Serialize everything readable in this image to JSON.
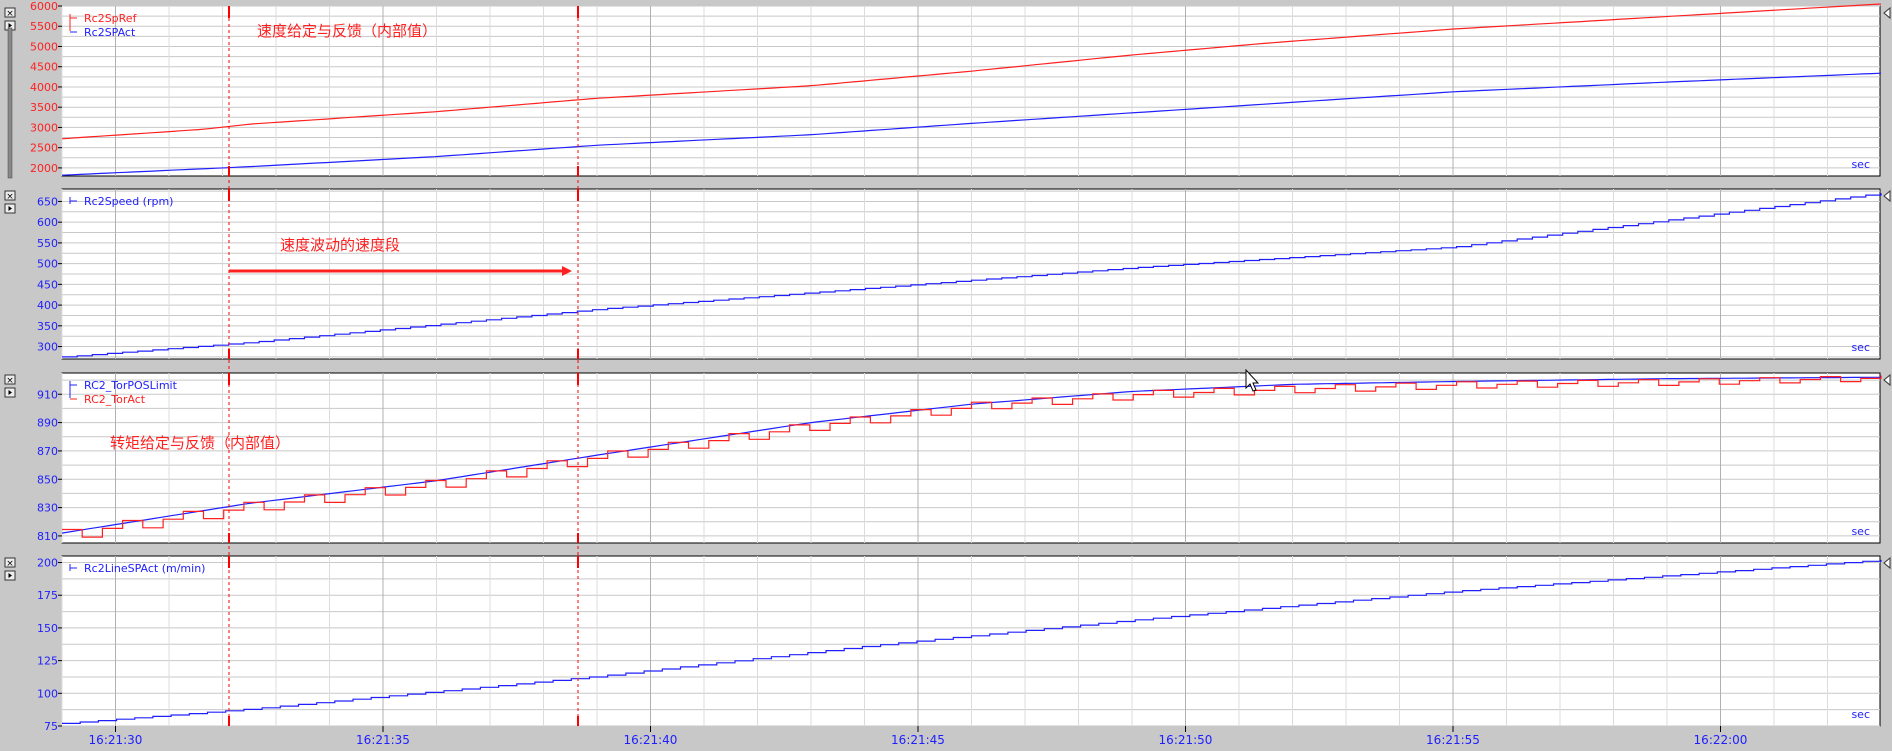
{
  "colors": {
    "ref": "#ff2020",
    "act": "#2020ff",
    "grid": "#c8c8c8",
    "plot_bg": "#ffffff",
    "cursor": "#ff0000"
  },
  "time_axis": {
    "ticks": [
      "16:21:30",
      "16:21:35",
      "16:21:40",
      "16:21:45",
      "16:21:50",
      "16:21:55",
      "16:22:00"
    ],
    "unit_label": "sec"
  },
  "annotations": {
    "speed_ref_feedback": "速度给定与反馈（内部值）",
    "speed_fluctuation": "速度波动的速度段",
    "torque_ref_feedback": "转矩给定与反馈（内部值）"
  },
  "cursors": {
    "t1": "16:21:31.9",
    "t2": "16:21:38.4"
  },
  "chart_data": [
    {
      "type": "line",
      "ylim": [
        1800,
        6000
      ],
      "yticks": [
        2000,
        2500,
        3000,
        3500,
        4000,
        4500,
        5000,
        5500,
        6000
      ],
      "ytick_color": "#ff2020",
      "x_range_sec": [
        0,
        34.0
      ],
      "series": [
        {
          "name": "Rc2SpRef",
          "color": "#ff2020",
          "x": [
            0,
            2.6,
            3.5,
            7,
            10,
            14,
            17,
            20,
            22.5,
            26,
            30,
            34.0
          ],
          "values": [
            2720,
            2950,
            3080,
            3390,
            3720,
            4030,
            4390,
            4790,
            5080,
            5430,
            5740,
            6050
          ],
          "steps": 0
        },
        {
          "name": "Rc2SPAct",
          "color": "#2020ff",
          "x": [
            0,
            3.5,
            7,
            10,
            14,
            17,
            20,
            26,
            30,
            34.0
          ],
          "values": [
            1820,
            2030,
            2280,
            2560,
            2820,
            3100,
            3360,
            3880,
            4120,
            4340
          ],
          "steps": 0
        }
      ]
    },
    {
      "type": "line",
      "ylim": [
        270,
        680
      ],
      "yticks": [
        300,
        350,
        400,
        450,
        500,
        550,
        600,
        650
      ],
      "ytick_color": "#2020ff",
      "x_range_sec": [
        0,
        34.0
      ],
      "series": [
        {
          "name": "Rc2Speed (rpm)",
          "color": "#2020ff",
          "x": [
            0,
            3.5,
            10,
            15,
            20,
            26,
            34.0
          ],
          "values": [
            275,
            310,
            390,
            440,
            490,
            540,
            670
          ],
          "steps": 120
        }
      ]
    },
    {
      "type": "line",
      "ylim": [
        805,
        925
      ],
      "yticks": [
        810,
        830,
        850,
        870,
        890,
        910
      ],
      "ytick_color": "#2020ff",
      "x_range_sec": [
        0,
        34.0
      ],
      "series": [
        {
          "name": "RC2_TorPOSLimit",
          "color": "#2020ff",
          "x": [
            0,
            3.5,
            7,
            10,
            14,
            17,
            20,
            23,
            26,
            30,
            34.0
          ],
          "values": [
            812,
            833,
            849,
            867,
            890,
            903,
            912,
            917,
            919,
            921,
            922
          ],
          "steps": 0
        },
        {
          "name": "RC2_TorAct",
          "color": "#ff2020",
          "x": [
            0,
            3.5,
            7,
            10,
            14,
            17,
            20,
            23,
            26,
            30,
            34.0
          ],
          "values": [
            810,
            830,
            846,
            865,
            887,
            901,
            909,
            913,
            916,
            918,
            921
          ],
          "steps": 90,
          "ripple": 5
        }
      ]
    },
    {
      "type": "line",
      "ylim": [
        75,
        205
      ],
      "yticks": [
        75,
        100,
        125,
        150,
        175,
        200
      ],
      "ytick_color": "#2020ff",
      "x_range_sec": [
        0,
        34.0
      ],
      "series": [
        {
          "name": "Rc2LineSPAct (m/min)",
          "color": "#2020ff",
          "x": [
            0,
            3.5,
            10,
            15,
            20,
            26,
            34.0
          ],
          "values": [
            77,
            88,
            113,
            136,
            156,
            178,
            202
          ],
          "steps": 100
        }
      ]
    }
  ]
}
